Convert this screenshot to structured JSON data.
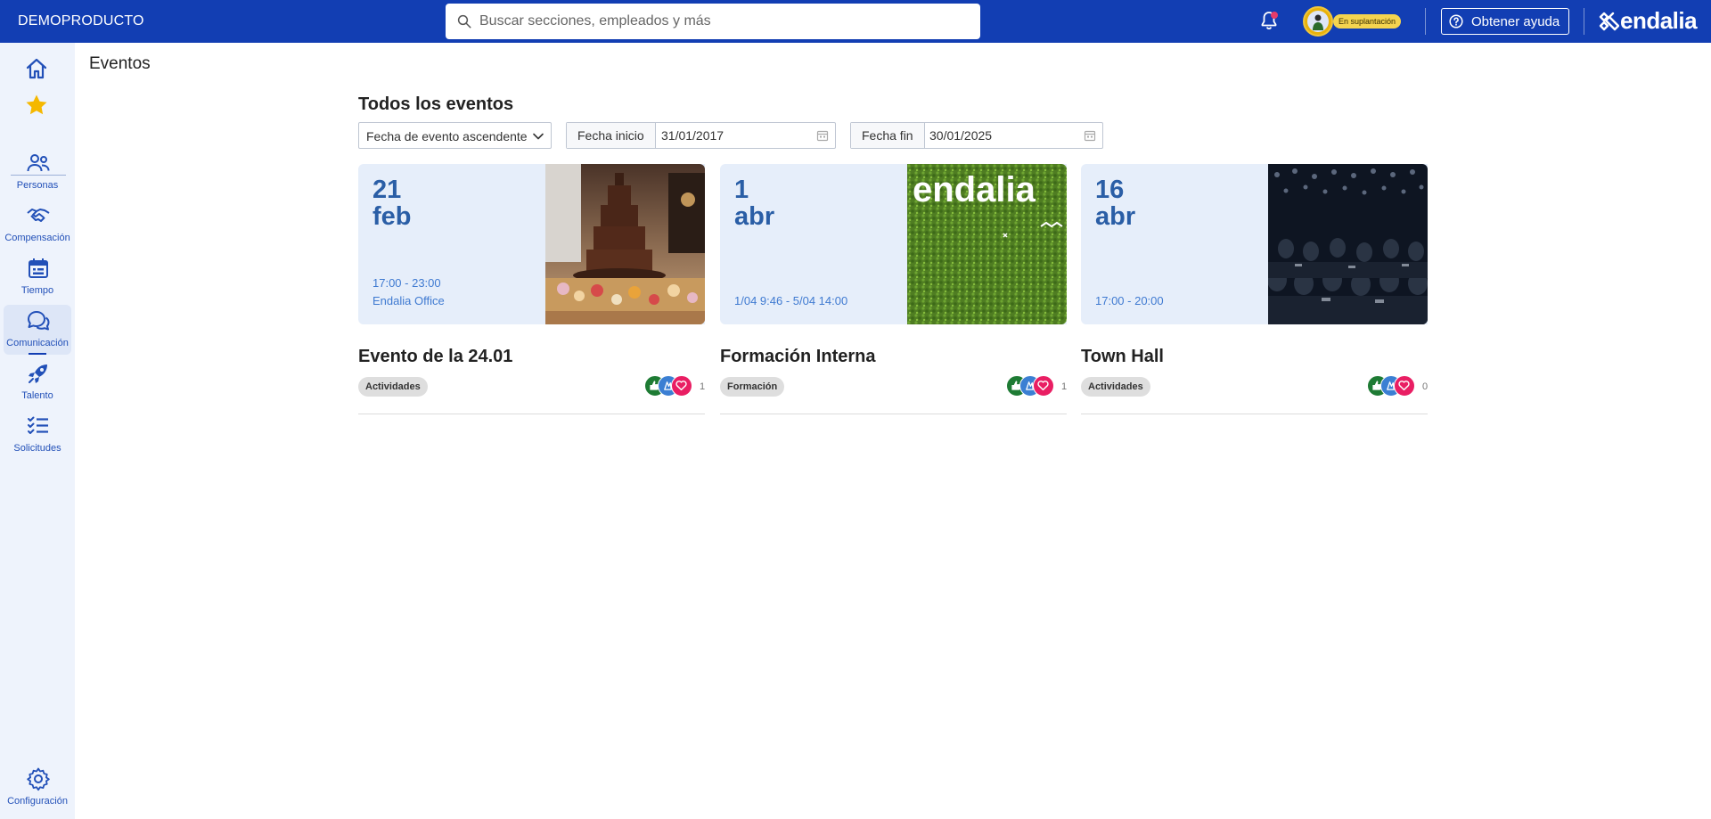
{
  "app": {
    "brand": "DEMOPRODUCTO",
    "logo_text": "endalia",
    "impersonation_label": "En suplantación",
    "help_label": "Obtener ayuda",
    "colors": {
      "primary": "#123eb3",
      "sidebar_bg": "#eef3fc",
      "accent_date": "#2a5ea6",
      "tag_bg": "#dedede"
    }
  },
  "search": {
    "placeholder": "Buscar secciones, empleados y más"
  },
  "sidebar": {
    "top_icons": [
      "home-icon",
      "star-icon"
    ],
    "items": [
      {
        "label": "Personas",
        "icon": "people-icon"
      },
      {
        "label": "Compensación",
        "icon": "handshake-icon"
      },
      {
        "label": "Tiempo",
        "icon": "calendar-icon"
      },
      {
        "label": "Comunicación",
        "icon": "chat-icon",
        "active": true
      },
      {
        "label": "Talento",
        "icon": "rocket-icon"
      },
      {
        "label": "Solicitudes",
        "icon": "checklist-icon"
      }
    ],
    "bottom": {
      "label": "Configuración",
      "icon": "gear-icon"
    }
  },
  "page": {
    "title": "Eventos",
    "section_title": "Todos los eventos",
    "filters": {
      "sort_value": "Fecha de evento ascendente",
      "start_label": "Fecha inicio",
      "start_value": "31/01/2017",
      "end_label": "Fecha fin",
      "end_value": "30/01/2025"
    }
  },
  "events": [
    {
      "day": "21",
      "month": "feb",
      "time": "17:00 - 23:00",
      "location": "Endalia Office",
      "title": "Evento de la 24.01",
      "tag": "Actividades",
      "reactions_count": "1",
      "image": "chocolate-fountain-image"
    },
    {
      "day": "1",
      "month": "abr",
      "time": "1/04 9:46 - 5/04 14:00",
      "location": "",
      "title": "Formación Interna",
      "tag": "Formación",
      "reactions_count": "1",
      "image": "endalia-grass-wall-image",
      "image_text": "endalia"
    },
    {
      "day": "16",
      "month": "abr",
      "time": "17:00 - 20:00",
      "location": "",
      "title": "Town Hall",
      "tag": "Actividades",
      "reactions_count": "0",
      "image": "conference-audience-image"
    }
  ]
}
